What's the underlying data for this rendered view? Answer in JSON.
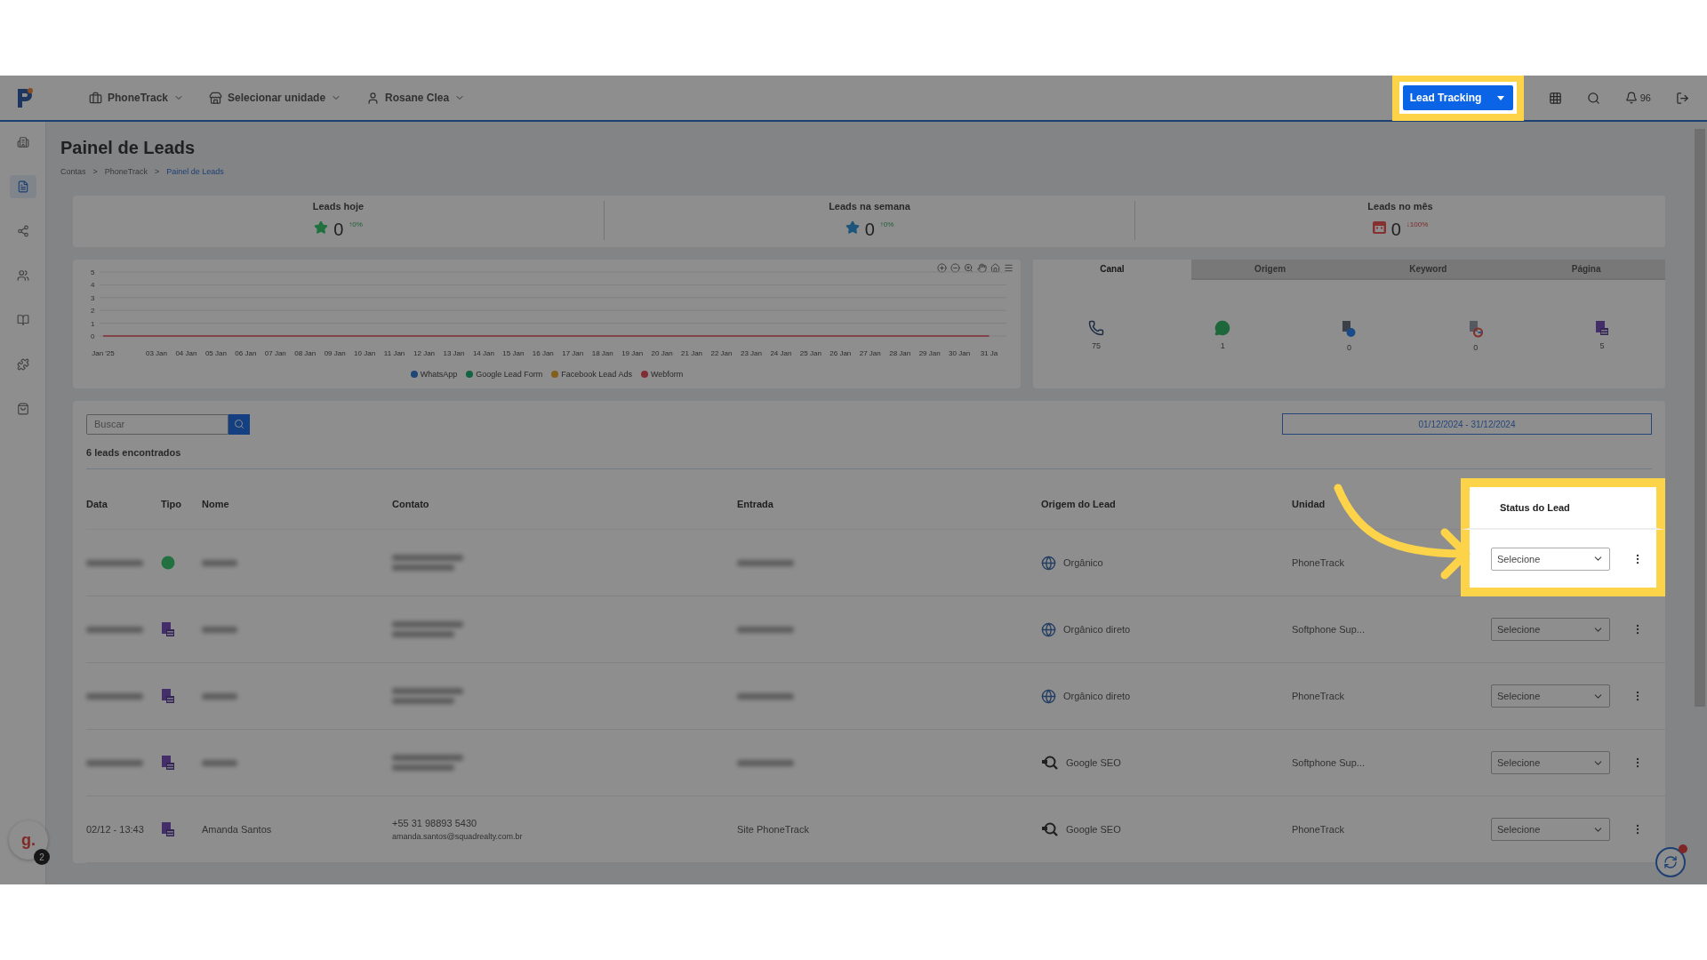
{
  "header": {
    "nav": [
      {
        "label": "PhoneTrack",
        "kind": "briefcase"
      },
      {
        "label": "Selecionar unidade",
        "kind": "store"
      },
      {
        "label": "Rosane Clea",
        "kind": "user"
      }
    ],
    "lead_button": {
      "label": "Lead Tracking",
      "highlighted": true
    },
    "notifications": "96"
  },
  "sidebar": {
    "items": [
      {
        "kind": "building",
        "selected": false
      },
      {
        "kind": "doc",
        "selected": true
      },
      {
        "kind": "nodes",
        "selected": false
      },
      {
        "kind": "users",
        "selected": false
      },
      {
        "kind": "book",
        "selected": false
      },
      {
        "kind": "puzzle",
        "selected": false
      },
      {
        "kind": "shop",
        "selected": false
      }
    ],
    "avatar": {
      "letter": "g.",
      "badge": "2"
    }
  },
  "page": {
    "title": "Painel de Leads",
    "breadcrumb": [
      "Contas",
      "PhoneTrack",
      "Painel de Leads"
    ],
    "separator": ">"
  },
  "stats": [
    {
      "label": "Leads hoje",
      "kind": "star",
      "color": "#20713e",
      "value": "0",
      "change": "↑0%",
      "declining": false
    },
    {
      "label": "Leads na semana",
      "kind": "star",
      "color": "#1d567a",
      "value": "0",
      "change": "↑0%",
      "declining": false
    },
    {
      "label": "Leads no mês",
      "kind": "calendar",
      "color": "#863131",
      "value": "0",
      "change": "↓100%",
      "declining": true
    }
  ],
  "chart_data": {
    "type": "line",
    "grid": true,
    "categories": [
      "Jan '25",
      "03 Jan",
      "04 Jan",
      "05 Jan",
      "06 Jan",
      "07 Jan",
      "08 Jan",
      "09 Jan",
      "10 Jan",
      "11 Jan",
      "12 Jan",
      "13 Jan",
      "14 Jan",
      "15 Jan",
      "16 Jan",
      "17 Jan",
      "18 Jan",
      "19 Jan",
      "20 Jan",
      "21 Jan",
      "22 Jan",
      "23 Jan",
      "24 Jan",
      "25 Jan",
      "26 Jan",
      "27 Jan",
      "28 Jan",
      "29 Jan",
      "30 Jan",
      "31 Ja"
    ],
    "yticks": [
      0,
      1,
      2,
      3,
      4,
      5
    ],
    "ylim": [
      0,
      5
    ],
    "series": [
      {
        "name": "WhatsApp",
        "color": "#1e4677",
        "values": [
          null,
          null,
          null,
          null,
          null,
          null,
          null,
          null,
          null,
          null,
          null,
          null,
          null,
          null,
          null,
          null,
          null,
          null,
          null,
          null,
          null,
          null,
          null,
          null,
          null,
          null,
          null,
          null,
          null,
          null
        ]
      },
      {
        "name": "Google Lead Form",
        "color": "#166343",
        "values": [
          null,
          null,
          null,
          null,
          null,
          null,
          null,
          null,
          null,
          null,
          null,
          null,
          null,
          null,
          null,
          null,
          null,
          null,
          null,
          null,
          null,
          null,
          null,
          null,
          null,
          null,
          null,
          null,
          null,
          null
        ]
      },
      {
        "name": "Facebook Lead Ads",
        "color": "#83601a",
        "values": [
          null,
          null,
          null,
          null,
          null,
          null,
          null,
          null,
          null,
          null,
          null,
          null,
          null,
          null,
          null,
          null,
          null,
          null,
          null,
          null,
          null,
          null,
          null,
          null,
          null,
          null,
          null,
          null,
          null,
          null
        ]
      },
      {
        "name": "Webform",
        "color": "#802d34",
        "values": [
          0,
          0,
          0,
          0,
          0,
          0,
          0,
          0,
          0,
          0,
          0,
          0,
          0,
          0,
          0,
          0,
          0,
          0,
          0,
          0,
          0,
          0,
          0,
          0,
          0,
          0,
          0,
          0,
          0,
          0
        ]
      }
    ]
  },
  "channels": {
    "tabs": [
      {
        "label": "Canal",
        "selected": true
      },
      {
        "label": "Origem",
        "selected": false
      },
      {
        "label": "Keyword",
        "selected": false
      },
      {
        "label": "Página",
        "selected": false
      }
    ],
    "items": [
      {
        "kind": "phone",
        "count": "75"
      },
      {
        "kind": "whatsapp",
        "count": "1"
      },
      {
        "kind": "facebook",
        "count": "0"
      },
      {
        "kind": "google",
        "count": "0"
      },
      {
        "kind": "webform",
        "count": "5"
      }
    ]
  },
  "search": {
    "placeholder": "Buscar"
  },
  "date_range": "01/12/2024 - 31/12/2024",
  "result_count": "6 leads encontrados",
  "table": {
    "columns": [
      {
        "label": "Data",
        "highlighted": false
      },
      {
        "label": "Tipo",
        "highlighted": false
      },
      {
        "label": "Nome",
        "highlighted": false
      },
      {
        "label": "Contato",
        "highlighted": false
      },
      {
        "label": "Entrada",
        "highlighted": false
      },
      {
        "label": "Origem do Lead",
        "highlighted": false
      },
      {
        "label": "Unidad",
        "highlighted": false
      },
      {
        "label": "Status do Lead",
        "highlighted": true
      }
    ],
    "rows": [
      {
        "kind": "blurred",
        "tipo": {
          "kind": "whatsapp"
        },
        "origin": {
          "kind": "globe",
          "label": "Orgânico"
        },
        "unit": "PhoneTrack",
        "status": "Selecione",
        "highlighted": true
      },
      {
        "kind": "blurred",
        "tipo": {
          "kind": "webform"
        },
        "origin": {
          "kind": "globe",
          "label": "Orgânico direto"
        },
        "unit": "Softphone Sup...",
        "status": "Selecione",
        "highlighted": false
      },
      {
        "kind": "blurred",
        "tipo": {
          "kind": "webform"
        },
        "origin": {
          "kind": "globe",
          "label": "Orgânico direto"
        },
        "unit": "PhoneTrack",
        "status": "Selecione",
        "highlighted": false
      },
      {
        "kind": "blurred",
        "tipo": {
          "kind": "webform"
        },
        "origin": {
          "kind": "seo",
          "label": "Google SEO"
        },
        "unit": "Softphone Sup...",
        "status": "Selecione",
        "highlighted": false
      },
      {
        "kind": "plain",
        "date": "02/12 - 13:43",
        "tipo": {
          "kind": "webform"
        },
        "name": "Amanda Santos",
        "phone": "+55 31 98893 5430",
        "email": "amanda.santos@squadrealty.com.br",
        "entry": "Site PhoneTrack",
        "origin": {
          "kind": "seo",
          "label": "Google SEO"
        },
        "unit": "PhoneTrack",
        "status": "Selecione",
        "highlighted": false
      }
    ]
  }
}
